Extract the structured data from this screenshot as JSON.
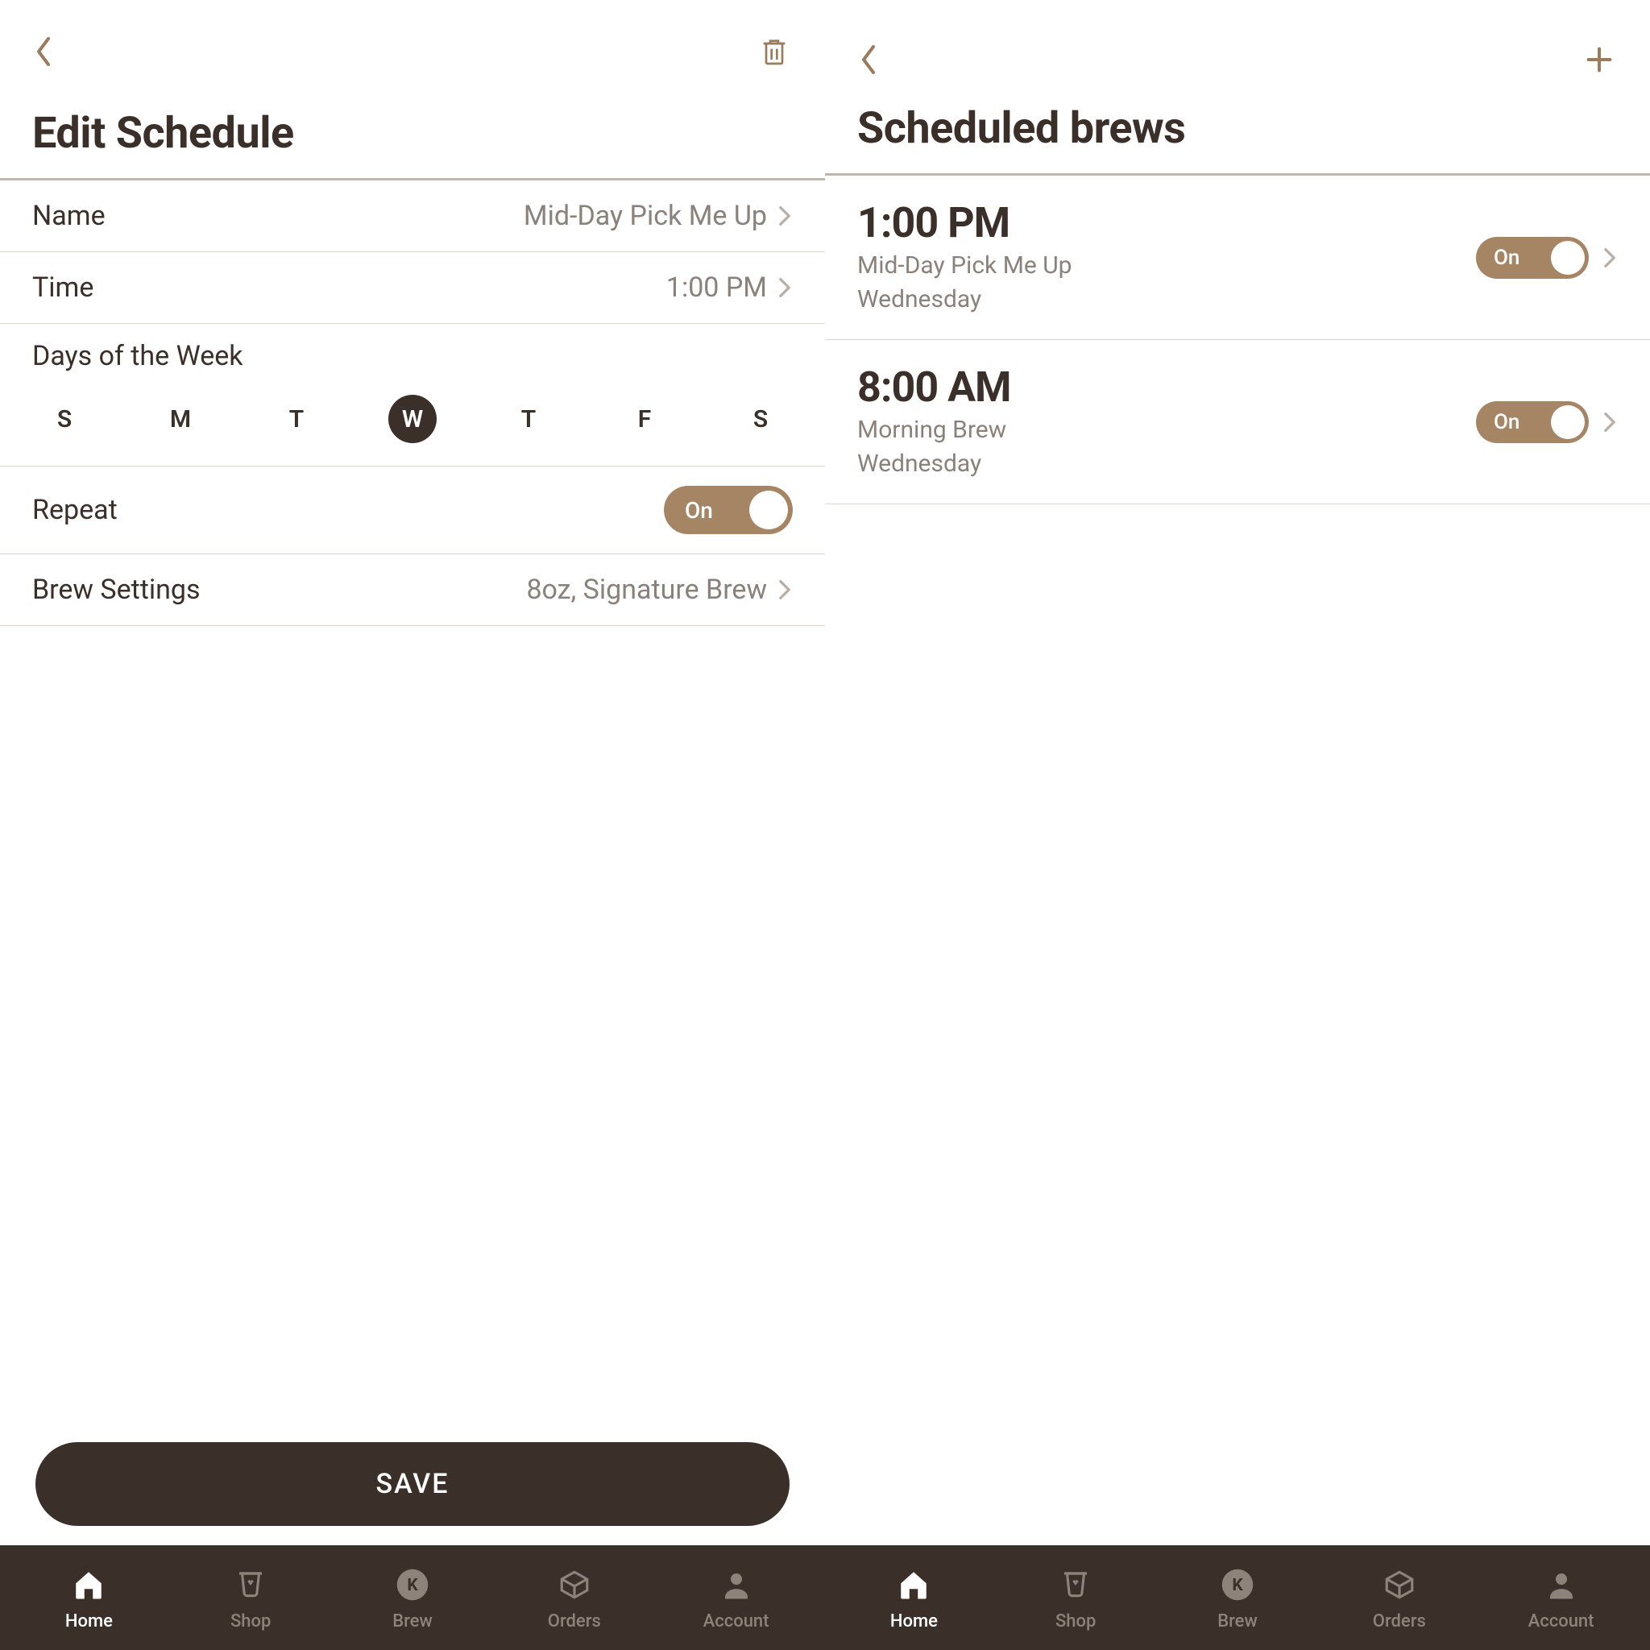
{
  "left": {
    "title": "Edit Schedule",
    "name_label": "Name",
    "name_value": "Mid-Day Pick Me Up",
    "time_label": "Time",
    "time_value": "1:00 PM",
    "days_label": "Days of the Week",
    "days": [
      "S",
      "M",
      "T",
      "W",
      "T",
      "F",
      "S"
    ],
    "days_selected_index": 3,
    "repeat_label": "Repeat",
    "repeat_toggle": "On",
    "brew_label": "Brew Settings",
    "brew_value": "8oz, Signature Brew",
    "save": "SAVE"
  },
  "right": {
    "title": "Scheduled brews",
    "items": [
      {
        "time": "1:00 PM",
        "name": "Mid-Day Pick Me Up",
        "day": "Wednesday",
        "toggle": "On"
      },
      {
        "time": "8:00 AM",
        "name": "Morning Brew",
        "day": "Wednesday",
        "toggle": "On"
      }
    ]
  },
  "tabs": [
    {
      "label": "Home"
    },
    {
      "label": "Shop"
    },
    {
      "label": "Brew"
    },
    {
      "label": "Orders"
    },
    {
      "label": "Account"
    }
  ],
  "active_tab_index": 0
}
